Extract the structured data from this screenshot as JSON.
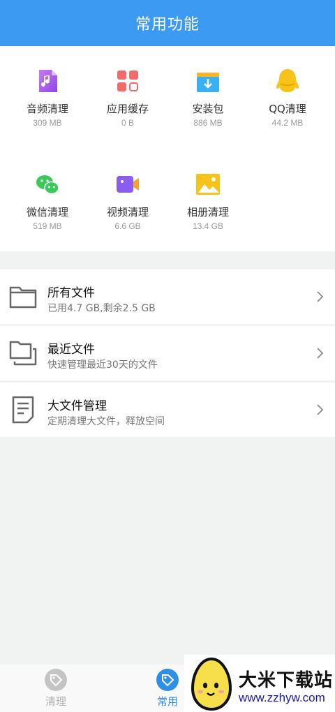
{
  "header": {
    "title": "常用功能"
  },
  "tools": [
    {
      "label": "音频清理",
      "size": "309 MB",
      "icon": "audio-file-icon"
    },
    {
      "label": "应用缓存",
      "size": "0 B",
      "icon": "app-grid-icon"
    },
    {
      "label": "安装包",
      "size": "886 MB",
      "icon": "install-box-icon"
    },
    {
      "label": "QQ清理",
      "size": "44.2 MB",
      "icon": "qq-penguin-icon"
    },
    {
      "label": "微信清理",
      "size": "519 MB",
      "icon": "wechat-icon"
    },
    {
      "label": "视频清理",
      "size": "6.6 GB",
      "icon": "video-camera-icon"
    },
    {
      "label": "相册清理",
      "size": "13.4 GB",
      "icon": "photo-album-icon"
    }
  ],
  "files": [
    {
      "title": "所有文件",
      "subtitle": "已用4.7 GB,剩余2.5 GB",
      "icon": "folder-icon"
    },
    {
      "title": "最近文件",
      "subtitle": "快速管理最近30天的文件",
      "icon": "stacked-folder-icon"
    },
    {
      "title": "大文件管理",
      "subtitle": "定期清理大文件，释放空间",
      "icon": "document-icon"
    }
  ],
  "tabs": [
    {
      "label": "清理",
      "active": false
    },
    {
      "label": "常用",
      "active": true
    }
  ],
  "watermark": {
    "title": "大米下载站",
    "url": "www.zzhyw.com"
  },
  "colors": {
    "header_bg": "#3d9af3",
    "active_tab": "#2f8fe6",
    "inactive_tab": "#b8b8b8"
  }
}
